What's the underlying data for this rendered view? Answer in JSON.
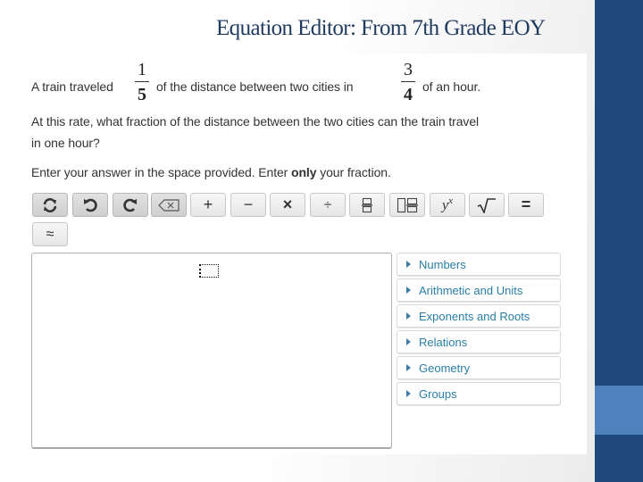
{
  "slide": {
    "title": "Equation Editor:  From 7th Grade EOY",
    "colors": {
      "title": "#1f3a5f",
      "side_bar": "#1f497d",
      "side_accent": "#4f81bd",
      "link": "#2a7ea5"
    }
  },
  "question": {
    "line1_a": "A train traveled",
    "fraction1": {
      "numerator": "1",
      "denominator": "5"
    },
    "line1_b": "of the distance between two cities in",
    "fraction2": {
      "numerator": "3",
      "denominator": "4"
    },
    "line1_c": "of an hour.",
    "line2": "At this rate, what fraction of the distance between the two cities can the train travel",
    "line3": "in one hour?",
    "instruction_a": "Enter your answer in the space provided. Enter ",
    "instruction_bold": "only",
    "instruction_b": " your fraction."
  },
  "toolbar": {
    "buttons": [
      {
        "name": "reset",
        "icon": "refresh-icon"
      },
      {
        "name": "undo",
        "icon": "undo-icon"
      },
      {
        "name": "redo",
        "icon": "redo-icon"
      },
      {
        "name": "backspace",
        "icon": "backspace-icon"
      },
      {
        "name": "plus",
        "icon": "plus-icon",
        "glyph": "+"
      },
      {
        "name": "minus",
        "icon": "minus-icon",
        "glyph": "−"
      },
      {
        "name": "times",
        "icon": "times-icon",
        "glyph": "×"
      },
      {
        "name": "divide",
        "icon": "divide-icon",
        "glyph": "÷"
      },
      {
        "name": "fraction",
        "icon": "fraction-icon"
      },
      {
        "name": "mixed-number",
        "icon": "mixed-number-icon"
      },
      {
        "name": "exponent",
        "icon": "exponent-icon",
        "glyph_base": "y",
        "glyph_sup": "x"
      },
      {
        "name": "square-root",
        "icon": "square-root-icon",
        "glyph": "√"
      },
      {
        "name": "equals",
        "icon": "equals-icon",
        "glyph": "="
      },
      {
        "name": "approximately",
        "icon": "approx-icon",
        "glyph": "≈"
      }
    ]
  },
  "editor": {
    "value": ""
  },
  "categories": [
    {
      "label": "Numbers"
    },
    {
      "label": "Arithmetic and Units"
    },
    {
      "label": "Exponents and Roots"
    },
    {
      "label": "Relations"
    },
    {
      "label": "Geometry"
    },
    {
      "label": "Groups"
    }
  ]
}
